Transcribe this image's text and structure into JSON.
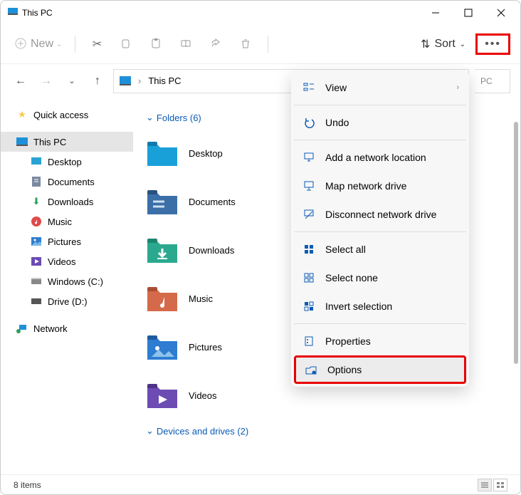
{
  "titlebar": {
    "title": "This PC"
  },
  "toolbar": {
    "new": "New",
    "sort": "Sort"
  },
  "breadcrumb": {
    "loc": "This PC"
  },
  "search": {
    "placeholder_visible": "PC"
  },
  "tree": {
    "quick": "Quick access",
    "thispc": "This PC",
    "children": [
      {
        "label": "Desktop"
      },
      {
        "label": "Documents"
      },
      {
        "label": "Downloads"
      },
      {
        "label": "Music"
      },
      {
        "label": "Pictures"
      },
      {
        "label": "Videos"
      },
      {
        "label": "Windows (C:)"
      },
      {
        "label": "Drive (D:)"
      }
    ],
    "network": "Network"
  },
  "content": {
    "folders_hdr": "Folders (6)",
    "folders": [
      {
        "label": "Desktop",
        "color": "#1aa0d8"
      },
      {
        "label": "Documents",
        "color": "#3b6fa8"
      },
      {
        "label": "Downloads",
        "color": "#2ba98e"
      },
      {
        "label": "Music",
        "color": "#d46a4a"
      },
      {
        "label": "Pictures",
        "color": "#2e7dd1"
      },
      {
        "label": "Videos",
        "color": "#6c4bb3"
      }
    ],
    "drives_hdr": "Devices and drives (2)"
  },
  "ctx": {
    "view": "View",
    "undo": "Undo",
    "addnet": "Add a network location",
    "mapdrive": "Map network drive",
    "disconnect": "Disconnect network drive",
    "selectall": "Select all",
    "selectnone": "Select none",
    "invert": "Invert selection",
    "properties": "Properties",
    "options": "Options"
  },
  "status": {
    "count": "8 items"
  }
}
